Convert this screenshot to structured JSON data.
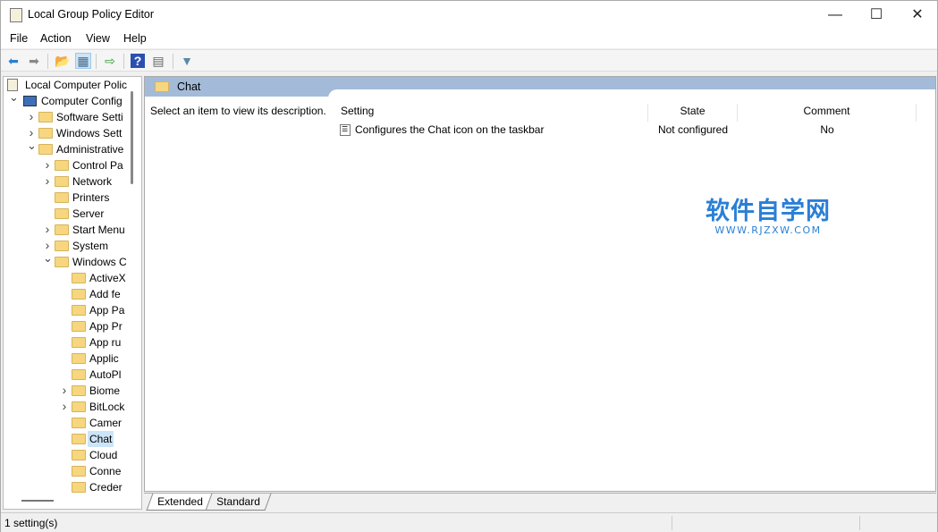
{
  "window": {
    "title": "Local Group Policy Editor",
    "minimize": "—",
    "maximize": "☐",
    "close": "✕"
  },
  "menu": [
    "File",
    "Action",
    "View",
    "Help"
  ],
  "toolbar": [
    {
      "name": "back-icon",
      "glyph": "⬅",
      "color": "#2b7fd0"
    },
    {
      "name": "forward-icon",
      "glyph": "➡",
      "color": "#888888"
    },
    {
      "name": "up-folder-icon",
      "glyph": "📂",
      "color": "#6a9a2a"
    },
    {
      "name": "show-hide-tree-icon",
      "glyph": "▦",
      "color": "#4a6b8a"
    },
    {
      "name": "export-list-icon",
      "glyph": "⇨",
      "color": "#3a9a3a"
    },
    {
      "name": "help-icon",
      "glyph": "?",
      "color": "#2a4fb0"
    },
    {
      "name": "properties-icon",
      "glyph": "▤",
      "color": "#666666"
    },
    {
      "name": "filter-icon",
      "glyph": "▼",
      "color": "#5a8aa8"
    }
  ],
  "tree": [
    {
      "label": "Local Computer Polic",
      "level": 0,
      "exp": "",
      "icon": "doc"
    },
    {
      "label": "Computer Config",
      "level": 1,
      "exp": "v",
      "icon": "computer"
    },
    {
      "label": "Software Setti",
      "level": 2,
      "exp": ">"
    },
    {
      "label": "Windows Sett",
      "level": 2,
      "exp": ">"
    },
    {
      "label": "Administrative",
      "level": 2,
      "exp": "v"
    },
    {
      "label": "Control Pa",
      "level": 3,
      "exp": ">"
    },
    {
      "label": "Network",
      "level": 3,
      "exp": ">"
    },
    {
      "label": "Printers",
      "level": 3,
      "exp": ""
    },
    {
      "label": "Server",
      "level": 3,
      "exp": ""
    },
    {
      "label": "Start Menu",
      "level": 3,
      "exp": ">"
    },
    {
      "label": "System",
      "level": 3,
      "exp": ">"
    },
    {
      "label": "Windows C",
      "level": 3,
      "exp": "v"
    },
    {
      "label": "ActiveX",
      "level": 4,
      "exp": ""
    },
    {
      "label": "Add fe",
      "level": 4,
      "exp": ""
    },
    {
      "label": "App Pa",
      "level": 4,
      "exp": ""
    },
    {
      "label": "App Pr",
      "level": 4,
      "exp": ""
    },
    {
      "label": "App ru",
      "level": 4,
      "exp": ""
    },
    {
      "label": "Applic",
      "level": 4,
      "exp": ""
    },
    {
      "label": "AutoPl",
      "level": 4,
      "exp": ""
    },
    {
      "label": "Biome",
      "level": 4,
      "exp": ">"
    },
    {
      "label": "BitLock",
      "level": 4,
      "exp": ">"
    },
    {
      "label": "Camer",
      "level": 4,
      "exp": ""
    },
    {
      "label": "Chat",
      "level": 4,
      "exp": "",
      "selected": true
    },
    {
      "label": "Cloud",
      "level": 4,
      "exp": ""
    },
    {
      "label": "Conne",
      "level": 4,
      "exp": ""
    },
    {
      "label": "Creder",
      "level": 4,
      "exp": ""
    }
  ],
  "main": {
    "header": "Chat",
    "description": "Select an item to view its description.",
    "columns": [
      "Setting",
      "State",
      "Comment"
    ],
    "rows": [
      {
        "setting": "Configures the Chat icon on the taskbar",
        "state": "Not configured",
        "comment": "No"
      }
    ],
    "tabs": [
      "Extended",
      "Standard"
    ],
    "header_color": "#a3bbd8"
  },
  "status": "1 setting(s)",
  "watermark": {
    "title": "软件自学网",
    "url": "WWW.RJZXW.COM"
  }
}
